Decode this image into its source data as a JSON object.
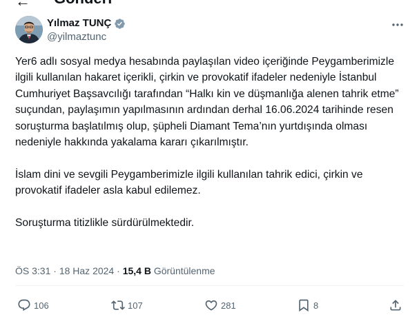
{
  "header": {
    "back_icon": "arrow-left-icon",
    "title": "Gönderi"
  },
  "author": {
    "display_name": "Yılmaz TUNÇ",
    "handle": "@yilmaztunc",
    "verified_badge_color": "#829aab",
    "avatar_icon": "profile-photo"
  },
  "tweet": {
    "paragraphs": [
      "Yer6 adlı sosyal medya hesabında paylaşılan video içeriğinde Peygamberimizle ilgili kullanılan hakaret içerikli, çirkin ve provokatif ifadeler nedeniyle İstanbul Cumhuriyet Başsavcılığı tarafından “Halkı kin ve düşmanlığa alenen tahrik etme” suçundan, paylaşımın yapılmasının ardından derhal 16.06.2024 tarihinde resen soruşturma başlatılmış olup, şüpheli Diamant Tema’nın yurtdışında olması nedeniyle hakkında yakalama kararı çıkarılmıştır.",
      "İslam dini ve sevgili Peygamberimizle ilgili kullanılan tahrik edici, çirkin ve provokatif ifadeler asla kabul edilemez.",
      "Soruşturma titizlikle sürdürülmektedir."
    ],
    "time": "ÖS 3:31",
    "separator": "·",
    "date": "18 Haz 2024",
    "views_count": "15,4 B",
    "views_label": "Görüntülenme"
  },
  "actions": {
    "replies": "106",
    "retweets": "107",
    "likes": "281",
    "bookmarks": "8"
  },
  "colors": {
    "text_primary": "#0f1419",
    "text_secondary": "#536471",
    "divider": "#eff3f4"
  }
}
